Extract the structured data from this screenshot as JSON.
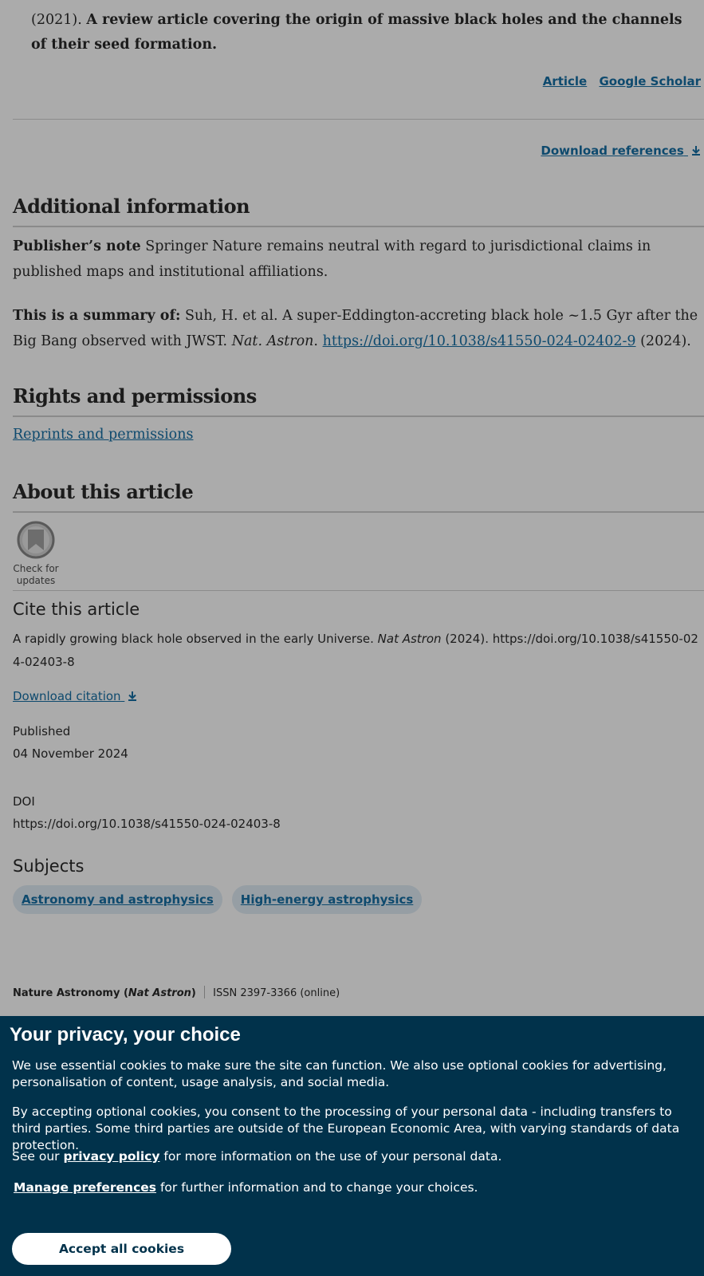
{
  "reference": {
    "prefix": "(2021).",
    "annotation": "A review article covering the origin of massive black holes and the channels of their seed formation.",
    "links": [
      "Article",
      "Google Scholar"
    ]
  },
  "download_references": "Download references",
  "additional_information": {
    "heading": "Additional information",
    "publisher_note_label": "Publisher’s note",
    "publisher_note_text": "Springer Nature remains neutral with regard to jurisdictional claims in published maps and institutional affiliations.",
    "summary_label": "This is a summary of:",
    "summary_text_1": "Suh, H. et al. A super-Eddington-accreting black hole ~1.5 Gyr after the Big Bang observed with JWST.",
    "summary_journal": "Nat. Astron",
    "summary_doi": "https://doi.org/10.1038/s41550-024-02402-9",
    "summary_year": "(2024)."
  },
  "rights": {
    "heading": "Rights and permissions",
    "link": "Reprints and permissions"
  },
  "about": {
    "heading": "About this article",
    "check_updates": [
      "Check for",
      "updates"
    ],
    "cite_heading": "Cite this article",
    "cite_text": "A rapidly growing black hole observed in the early Universe.",
    "cite_journal": "Nat Astron",
    "cite_rest": "(2024). https://doi.org/10.1038/s41550-024-02403-8",
    "download_citation": "Download citation",
    "published_label": "Published",
    "published_date": "04 November 2024",
    "doi_label": "DOI",
    "doi_value": "https://doi.org/10.1038/s41550-024-02403-8",
    "subjects_heading": "Subjects",
    "subjects": [
      "Astronomy and astrophysics",
      "High-energy astrophysics"
    ]
  },
  "footer": {
    "journal": "Nature Astronomy",
    "abbr": "Nat Astron",
    "issn": "ISSN 2397-3366 (online)"
  },
  "cookie": {
    "title": "Your privacy, your choice",
    "p1": "We use essential cookies to make sure the site can function. We also use optional cookies for advertising, personalisation of content, usage analysis, and social media.",
    "p2": "By accepting optional cookies, you consent to the processing of your personal data - including transfers to third parties. Some third parties are outside of the European Economic Area, with varying standards of data protection.",
    "p3_pre": "See our",
    "p3_link": "privacy policy",
    "p3_post": "for more information on the use of your personal data.",
    "p4_link": "Manage preferences",
    "p4_post": "for further information and to change your choices.",
    "accept": "Accept all cookies"
  }
}
